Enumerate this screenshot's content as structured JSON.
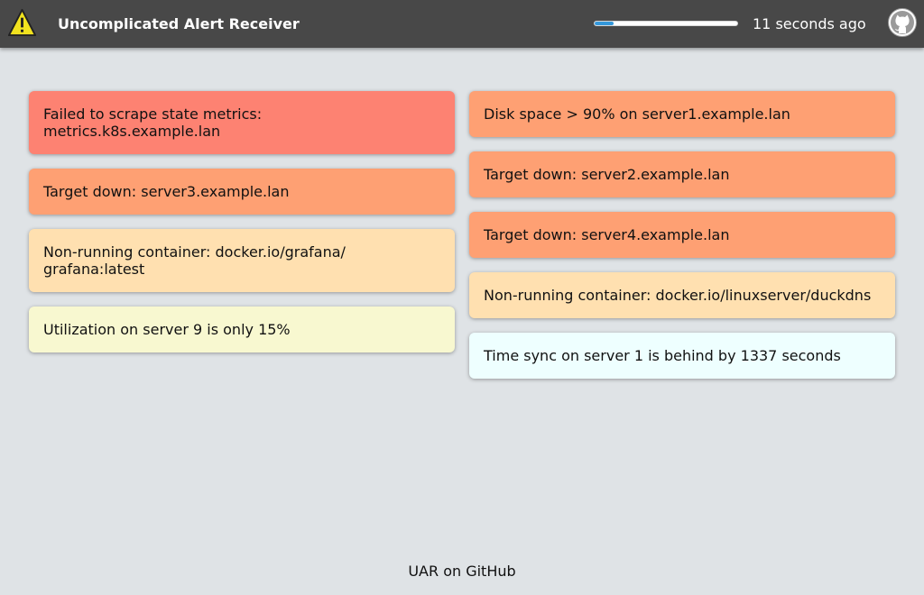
{
  "header": {
    "title": "Uncomplicated Alert Receiver",
    "logo_icon": "warning-triangle-icon",
    "refresh_progress": 0.13,
    "last_updated": "11 seconds ago",
    "github_icon": "github-icon"
  },
  "colors": {
    "critical": "#fd8272",
    "error": "#fea073",
    "warning": "#ffe0b0",
    "info": "#f8f8d0",
    "notice": "#eeffff",
    "progress_fill": "#3498db",
    "topbar": "#484848"
  },
  "alerts_left": [
    {
      "text": "Failed to scrape state metrics: metrics.k8s.example.lan",
      "severity": "critical"
    },
    {
      "text": "Target down: server3.example.lan",
      "severity": "error"
    },
    {
      "text": "Non-running container: docker.io/grafana/ grafana:latest",
      "severity": "warning"
    },
    {
      "text": "Utilization on server 9 is only 15%",
      "severity": "info"
    }
  ],
  "alerts_right": [
    {
      "text": "Disk space > 90% on server1.example.lan",
      "severity": "error"
    },
    {
      "text": "Target down: server2.example.lan",
      "severity": "error"
    },
    {
      "text": "Target down: server4.example.lan",
      "severity": "error"
    },
    {
      "text": "Non-running container: docker.io/linuxserver/duckdns",
      "severity": "warning"
    },
    {
      "text": "Time sync on server 1 is behind by 1337 seconds",
      "severity": "notice"
    }
  ],
  "footer": {
    "link_text": "UAR on GitHub"
  }
}
